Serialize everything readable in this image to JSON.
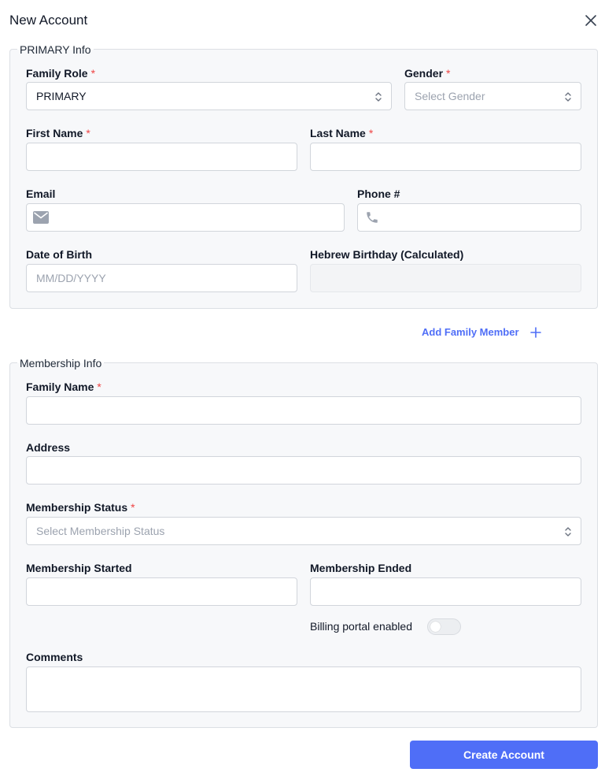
{
  "modal": {
    "title": "New Account",
    "close_icon": "close-icon",
    "submit_label": "Create Account"
  },
  "colors": {
    "accent": "#4f6ef7",
    "required": "#ef4444",
    "section_bg": "#f7f8fa"
  },
  "required_marker": "*",
  "primary_info": {
    "legend": "PRIMARY Info",
    "family_role": {
      "label": "Family Role",
      "value": "PRIMARY"
    },
    "gender": {
      "label": "Gender",
      "placeholder": "Select Gender"
    },
    "first_name": {
      "label": "First Name",
      "value": ""
    },
    "last_name": {
      "label": "Last Name",
      "value": ""
    },
    "email": {
      "label": "Email",
      "value": "",
      "icon": "envelope-icon"
    },
    "phone": {
      "label": "Phone #",
      "value": "",
      "icon": "phone-icon"
    },
    "dob": {
      "label": "Date of Birth",
      "placeholder": "MM/DD/YYYY"
    },
    "hebrew_birthday": {
      "label": "Hebrew Birthday (Calculated)",
      "value": ""
    }
  },
  "add_family_member": {
    "label": "Add Family Member",
    "icon": "plus-icon"
  },
  "membership_info": {
    "legend": "Membership Info",
    "family_name": {
      "label": "Family Name",
      "value": ""
    },
    "address": {
      "label": "Address",
      "value": ""
    },
    "membership_status": {
      "label": "Membership Status",
      "placeholder": "Select Membership Status"
    },
    "membership_started": {
      "label": "Membership Started",
      "value": ""
    },
    "membership_ended": {
      "label": "Membership Ended",
      "value": ""
    },
    "billing_portal": {
      "label": "Billing portal enabled",
      "enabled": false
    },
    "comments": {
      "label": "Comments",
      "value": ""
    }
  }
}
